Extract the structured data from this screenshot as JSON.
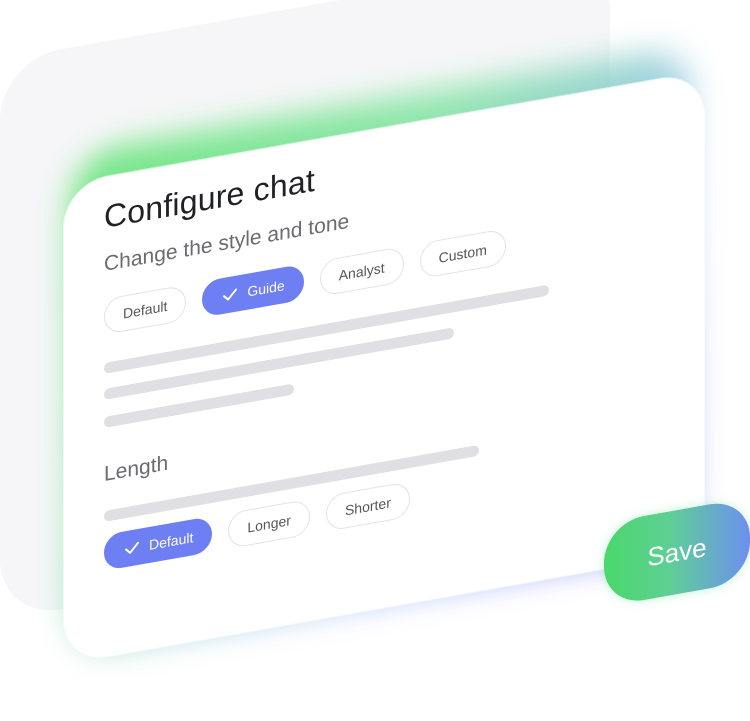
{
  "card": {
    "title": "Configure chat",
    "subtitle": "Change the style and tone"
  },
  "style_chips": [
    {
      "label": "Default",
      "selected": false
    },
    {
      "label": "Guide",
      "selected": true
    },
    {
      "label": "Analyst",
      "selected": false
    },
    {
      "label": "Custom",
      "selected": false
    }
  ],
  "length": {
    "label": "Length",
    "chips": [
      {
        "label": "Default",
        "selected": true
      },
      {
        "label": "Longer",
        "selected": false
      },
      {
        "label": "Shorter",
        "selected": false
      }
    ]
  },
  "save_label": "Save",
  "icons": {
    "selected_chip": "check-icon"
  },
  "colors": {
    "accent": "#6d7ff2",
    "save_gradient_start": "#49d86b",
    "save_gradient_end": "#6d8ff0"
  }
}
